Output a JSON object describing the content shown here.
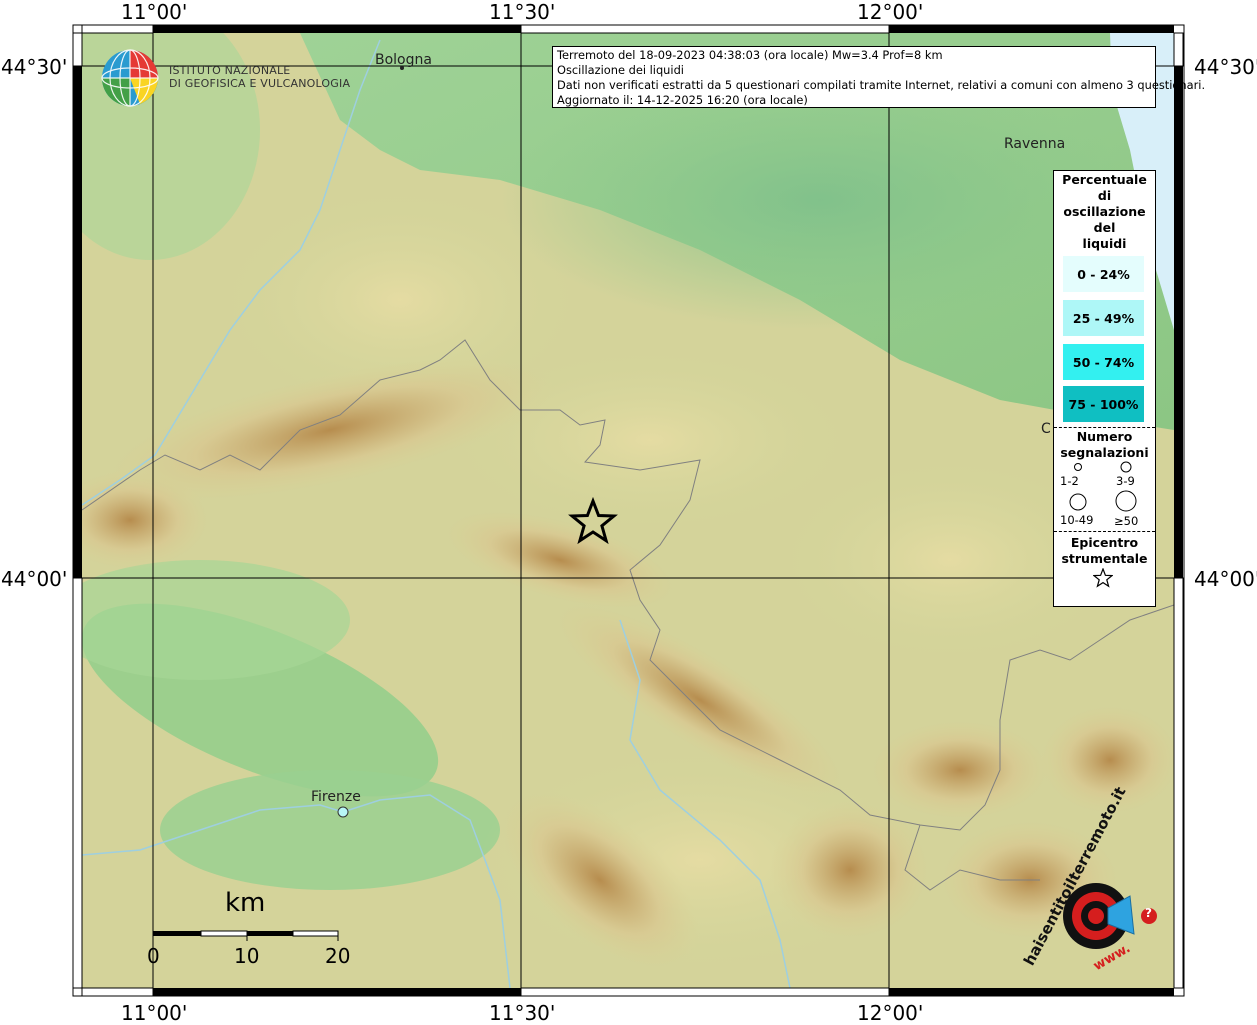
{
  "header": {
    "institute_line1": "ISTITUTO NAZIONALE",
    "institute_line2": "DI GEOFISICA E VULCANOLOGIA"
  },
  "info": {
    "line1": "Terremoto del 18-09-2023 04:38:03 (ora locale) Mw=3.4 Prof=8 km",
    "line2": "Oscillazione dei liquidi",
    "line3": "Dati non verificati estratti da 5 questionari compilati tramite Internet, relativi a comuni con almeno 3 questionari.",
    "line4": "Aggiornato il: 14-12-2025 16:20 (ora locale)"
  },
  "axes": {
    "top_lon": [
      "11°00'",
      "11°30'",
      "12°00'"
    ],
    "bottom_lon": [
      "11°00'",
      "11°30'",
      "12°00'"
    ],
    "left_lat": [
      "44°30'",
      "44°00'"
    ],
    "right_lat": [
      "44°30'",
      "44°00'"
    ]
  },
  "cities": {
    "bologna": "Bologna",
    "ravenna": "Ravenna",
    "firenze": "Firenze",
    "c_label": "C"
  },
  "legend": {
    "title": [
      "Percentuale",
      "di",
      "oscillazione",
      "del",
      "liquidi"
    ],
    "classes": [
      {
        "label": "0 - 24%",
        "color": "#e4fdfd"
      },
      {
        "label": "25 - 49%",
        "color": "#aef7f7"
      },
      {
        "label": "50 - 74%",
        "color": "#33f0f0"
      },
      {
        "label": "75 - 100%",
        "color": "#0fbfc2"
      }
    ],
    "count_title": [
      "Numero",
      "segnalazioni"
    ],
    "count_labels": [
      "1-2",
      "3-9",
      "10-49",
      "≥50"
    ],
    "epicenter_title": [
      "Epicentro",
      "strumentale"
    ]
  },
  "scale": {
    "unit": "km",
    "ticks": [
      "0",
      "10",
      "20"
    ]
  },
  "watermark": {
    "text": "haisentitoilterremoto.it",
    "www": "www.",
    "question": "?"
  },
  "colors": {
    "plain": "#8fcc8a",
    "hills": "#dccf98",
    "mountains": "#b98f4f",
    "sea": "#d9f0fb",
    "accent_red": "#d51e1e"
  }
}
